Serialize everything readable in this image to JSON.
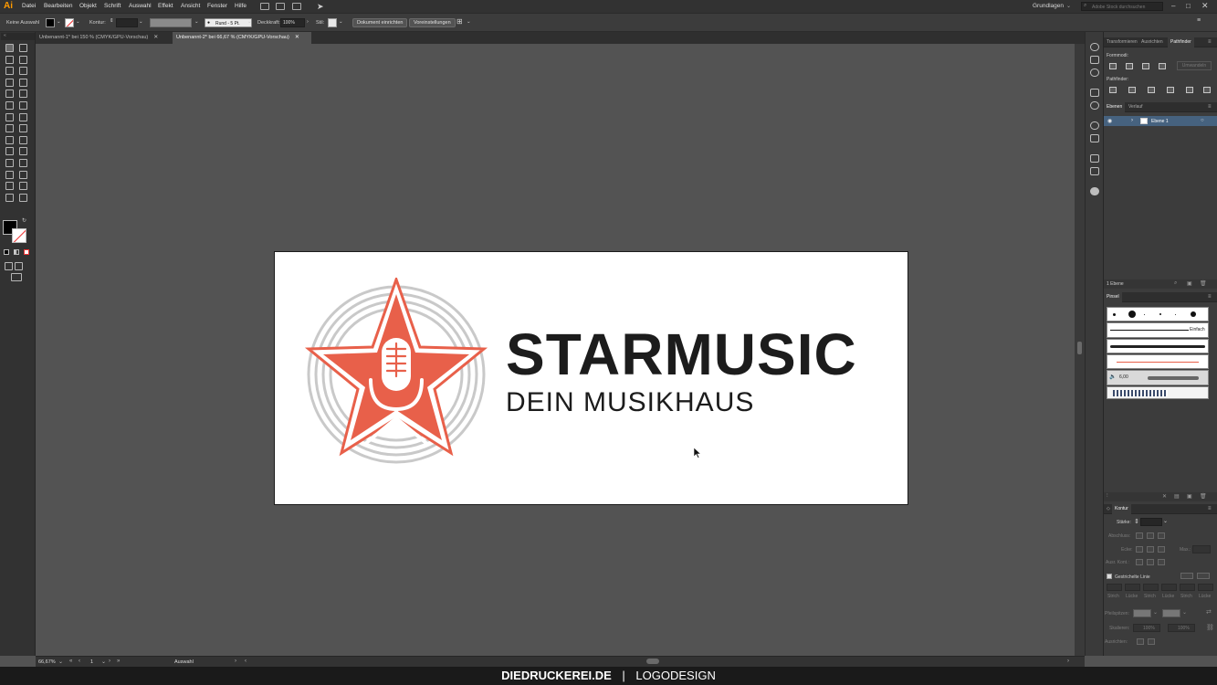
{
  "app": {
    "menu": [
      "Datei",
      "Bearbeiten",
      "Objekt",
      "Schrift",
      "Auswahl",
      "Effekt",
      "Ansicht",
      "Fenster",
      "Hilfe"
    ],
    "workspace": "Grundlagen",
    "stock_search_placeholder": "Adobe Stock durchsuchen"
  },
  "control_bar": {
    "selection": "Keine Auswahl",
    "stroke_label": "Kontur:",
    "brush": "Rund - 5 Pt.",
    "opacity_label": "Deckkraft:",
    "opacity_value": "100%",
    "style_label": "Stil:",
    "document_setup": "Dokument einrichten",
    "preferences": "Voreinstellungen"
  },
  "tabs": [
    {
      "label": "Unbenannt-1* bei 150 % (CMYK/GPU-Vorschau)",
      "active": false
    },
    {
      "label": "Unbenannt-2* bei 66,67 % (CMYK/GPU-Vorschau)",
      "active": true
    }
  ],
  "artwork": {
    "title": "STARMUSIC",
    "subtitle": "DEIN MUSIKHAUS",
    "accent_color": "#e8604a",
    "ring_color": "#c8c8c8"
  },
  "pathfinder_panel": {
    "tabs": [
      "Transformieren",
      "Ausrichten",
      "Pathfinder"
    ],
    "shape_modes_label": "Formmodi:",
    "pathfinders_label": "Pathfinder:",
    "expand_button": "Umwandeln"
  },
  "layers_panel": {
    "tabs": [
      "Ebenen",
      "Verlauf"
    ],
    "layer_name": "Ebene 1",
    "count": "1 Ebene"
  },
  "brushes_panel": {
    "title": "Pinsel",
    "basic_label": "Einfach",
    "size_value": "6,00"
  },
  "stroke_panel": {
    "title": "Kontur",
    "weight_label": "Stärke:",
    "cap_label": "Abschluss:",
    "corner_label": "Ecke:",
    "align_label": "Ausr. Kont.:",
    "limit_label": "Max.:",
    "dashed_label": "Gestrichelte Linie",
    "dash_labels": [
      "Strich",
      "Lücke",
      "Strich",
      "Lücke",
      "Strich",
      "Lücke"
    ],
    "arrowheads_label": "Pfeilspitzen:",
    "scale_label": "Skalieren:",
    "arrow_align_label": "Ausrichten:",
    "scale_values": [
      "100%",
      "100%"
    ],
    "profile_label": "Profil:"
  },
  "status_bar": {
    "zoom": "66,67%",
    "artboard": "1",
    "tool": "Auswahl"
  },
  "footer": {
    "site": "DIEDRUCKEREI.DE",
    "separator": "|",
    "label": "LOGODESIGN"
  }
}
